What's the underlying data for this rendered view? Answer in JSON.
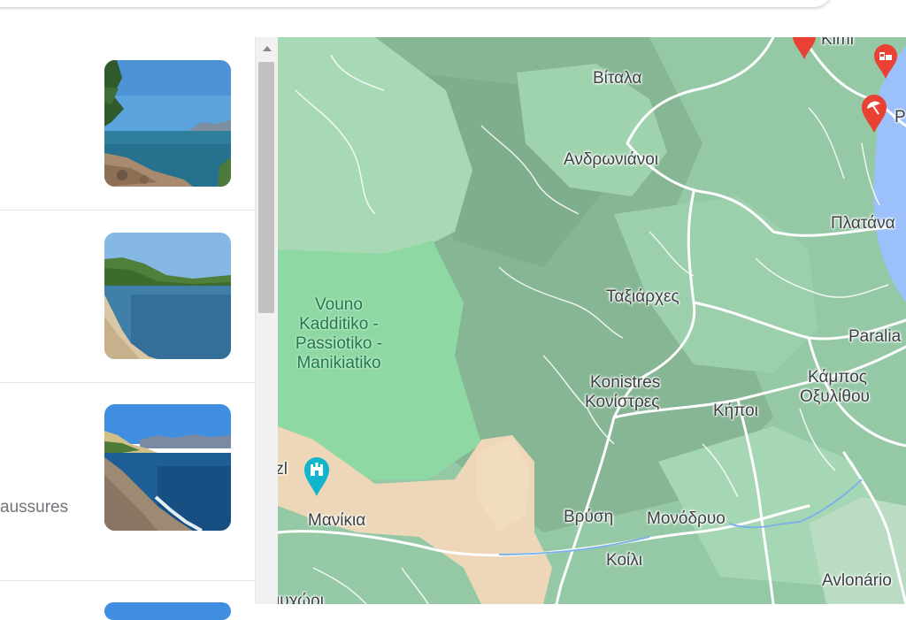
{
  "results": [
    {
      "snippet": "",
      "thumb": "beach-rocks-pine"
    },
    {
      "snippet": "",
      "thumb": "bay-sand-hills"
    },
    {
      "snippet": "aussures",
      "thumb": "pebble-shore-cliffs"
    },
    {
      "snippet": "",
      "thumb": "partial"
    }
  ],
  "map": {
    "places": [
      {
        "id": "kimi",
        "label": "Kimi"
      },
      {
        "id": "vitala",
        "label": "Βίταλα"
      },
      {
        "id": "andronianoi",
        "label": "Ανδρωνιάνοι"
      },
      {
        "id": "platana",
        "label": "Πλατάνα"
      },
      {
        "id": "taxiarches",
        "label": "Ταξιάρχες"
      },
      {
        "id": "paralia",
        "label": "Paralia"
      },
      {
        "id": "konistres-latin",
        "label": "Konistres"
      },
      {
        "id": "konistres-greek",
        "label": "Κονίστρες"
      },
      {
        "id": "kipoi",
        "label": "Κήποι"
      },
      {
        "id": "kampos-line1",
        "label": "Κάμπος"
      },
      {
        "id": "kampos-line2",
        "label": "Οξυλίθου"
      },
      {
        "id": "vrysi",
        "label": "Βρύση"
      },
      {
        "id": "monodryo",
        "label": "Μονόδρυο"
      },
      {
        "id": "koili",
        "label": "Κοίλι"
      },
      {
        "id": "manikia",
        "label": "Μανίκια"
      },
      {
        "id": "avlonario",
        "label": "Avlonário"
      },
      {
        "id": "bottom-cut",
        "label": "ιυχώρι"
      },
      {
        "id": "pin-cut",
        "label": "tzl"
      },
      {
        "id": "beach-cut",
        "label": "P"
      }
    ],
    "park": {
      "line1": "Vouno",
      "line2": "Kadditiko -",
      "line3": "Passiotiko -",
      "line4": "Manikiatiko"
    },
    "pins": [
      {
        "id": "hotel",
        "icon": "hotel-icon",
        "color": "#e94235"
      },
      {
        "id": "beach",
        "icon": "beach-umbrella-icon",
        "color": "#e94235"
      },
      {
        "id": "top",
        "icon": "marker-icon",
        "color": "#e94235"
      },
      {
        "id": "attraction",
        "icon": "castle-icon",
        "color": "#12b5cb"
      }
    ]
  }
}
